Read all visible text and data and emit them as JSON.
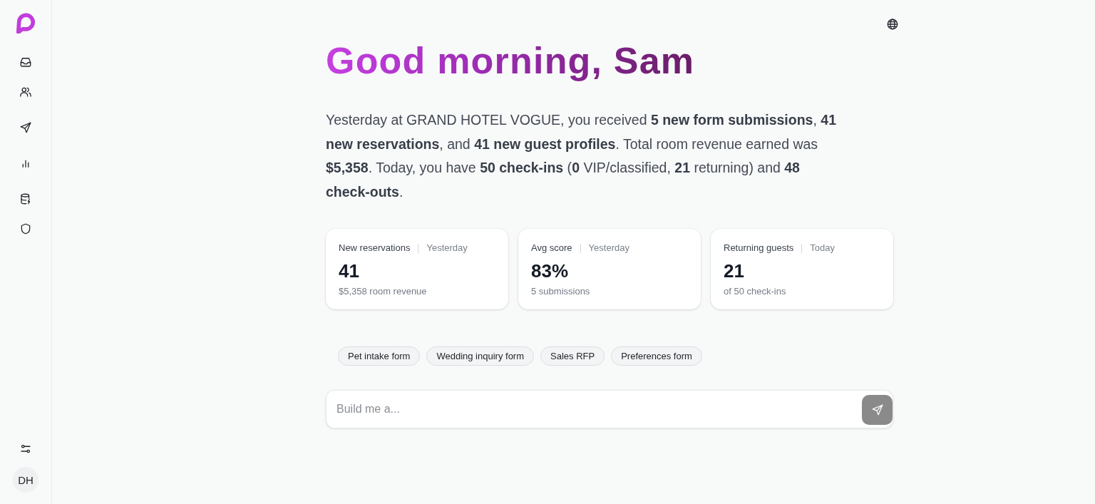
{
  "user": {
    "initials": "DH"
  },
  "greeting": "Good morning, Sam",
  "summary": "Yesterday at GRAND HOTEL VOGUE, you received **5 new form submissions**, **41 new reservations**, and **41 new guest profiles**. Total room revenue earned was **$5,358**. Today, you have **50 check-ins** (**0** VIP/classified, **21** returning) and **48 check-outs**.",
  "stat_cards": [
    {
      "label": "New reservations",
      "period": "Yesterday",
      "value": "41",
      "detail": "$5,358 room revenue"
    },
    {
      "label": "Avg score",
      "period": "Yesterday",
      "value": "83%",
      "detail": "5 submissions"
    },
    {
      "label": "Returning guests",
      "period": "Today",
      "value": "21",
      "detail": "of 50 check-ins"
    }
  ],
  "suggestions": [
    "Pet intake form",
    "Wedding inquiry form",
    "Sales RFP",
    "Preferences form"
  ],
  "prompt": {
    "placeholder": "Build me a..."
  }
}
